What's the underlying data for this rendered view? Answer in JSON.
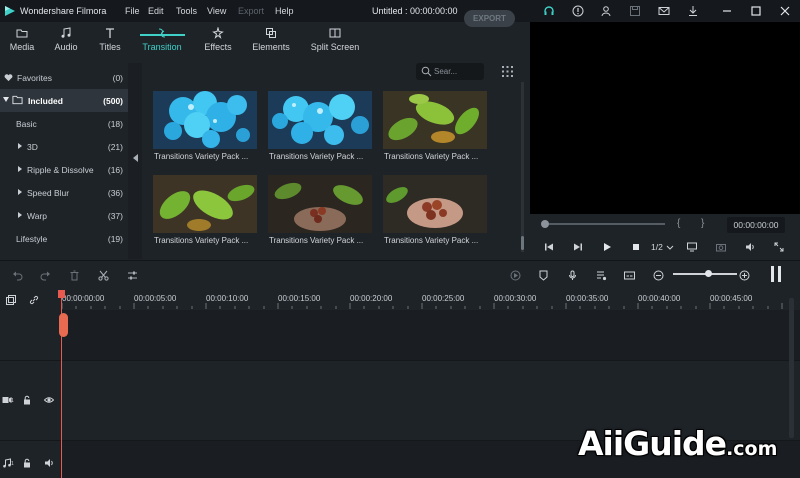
{
  "app": {
    "name": "Wondershare Filmora",
    "document_title": "Untitled : 00:00:00:00",
    "menu": [
      "File",
      "Edit",
      "Tools",
      "View",
      "Export",
      "Help"
    ],
    "accent": "#3fd0c8"
  },
  "tabs": [
    {
      "label": "Media",
      "icon": "folder-icon"
    },
    {
      "label": "Audio",
      "icon": "music-note-icon"
    },
    {
      "label": "Titles",
      "icon": "text-icon"
    },
    {
      "label": "Transition",
      "icon": "transition-icon"
    },
    {
      "label": "Effects",
      "icon": "effects-icon"
    },
    {
      "label": "Elements",
      "icon": "elements-icon"
    },
    {
      "label": "Split Screen",
      "icon": "split-screen-icon"
    }
  ],
  "export_label": "EXPORT",
  "sidebar": {
    "items": [
      {
        "label": "Favorites",
        "count": "(0)"
      },
      {
        "label": "Included",
        "count": "(500)"
      },
      {
        "label": "Basic",
        "count": "(18)"
      },
      {
        "label": "3D",
        "count": "(21)"
      },
      {
        "label": "Ripple & Dissolve",
        "count": "(16)"
      },
      {
        "label": "Speed Blur",
        "count": "(36)"
      },
      {
        "label": "Warp",
        "count": "(37)"
      },
      {
        "label": "Lifestyle",
        "count": "(19)"
      }
    ]
  },
  "search": {
    "placeholder": "Sear..."
  },
  "thumbnails": [
    {
      "label": "Transitions Variety Pack ..."
    },
    {
      "label": "Transitions Variety Pack ..."
    },
    {
      "label": "Transitions Variety Pack ..."
    },
    {
      "label": "Transitions Variety Pack ..."
    },
    {
      "label": "Transitions Variety Pack ..."
    },
    {
      "label": "Transitions Variety Pack ..."
    }
  ],
  "preview": {
    "timecode": "00:00:00:00",
    "brace_open": "{",
    "brace_close": "}",
    "ratio": "1/2"
  },
  "timeline": {
    "ticks": [
      "00:00:00:00",
      "00:00:05:00",
      "00:00:10:00",
      "00:00:15:00",
      "00:00:20:00",
      "00:00:25:00",
      "00:00:30:00",
      "00:00:35:00",
      "00:00:40:00",
      "00:00:45:00"
    ],
    "video_track_num": "1",
    "audio_track_num": "1"
  },
  "watermark": {
    "main": "AiiGuide",
    "tld": ".com"
  }
}
